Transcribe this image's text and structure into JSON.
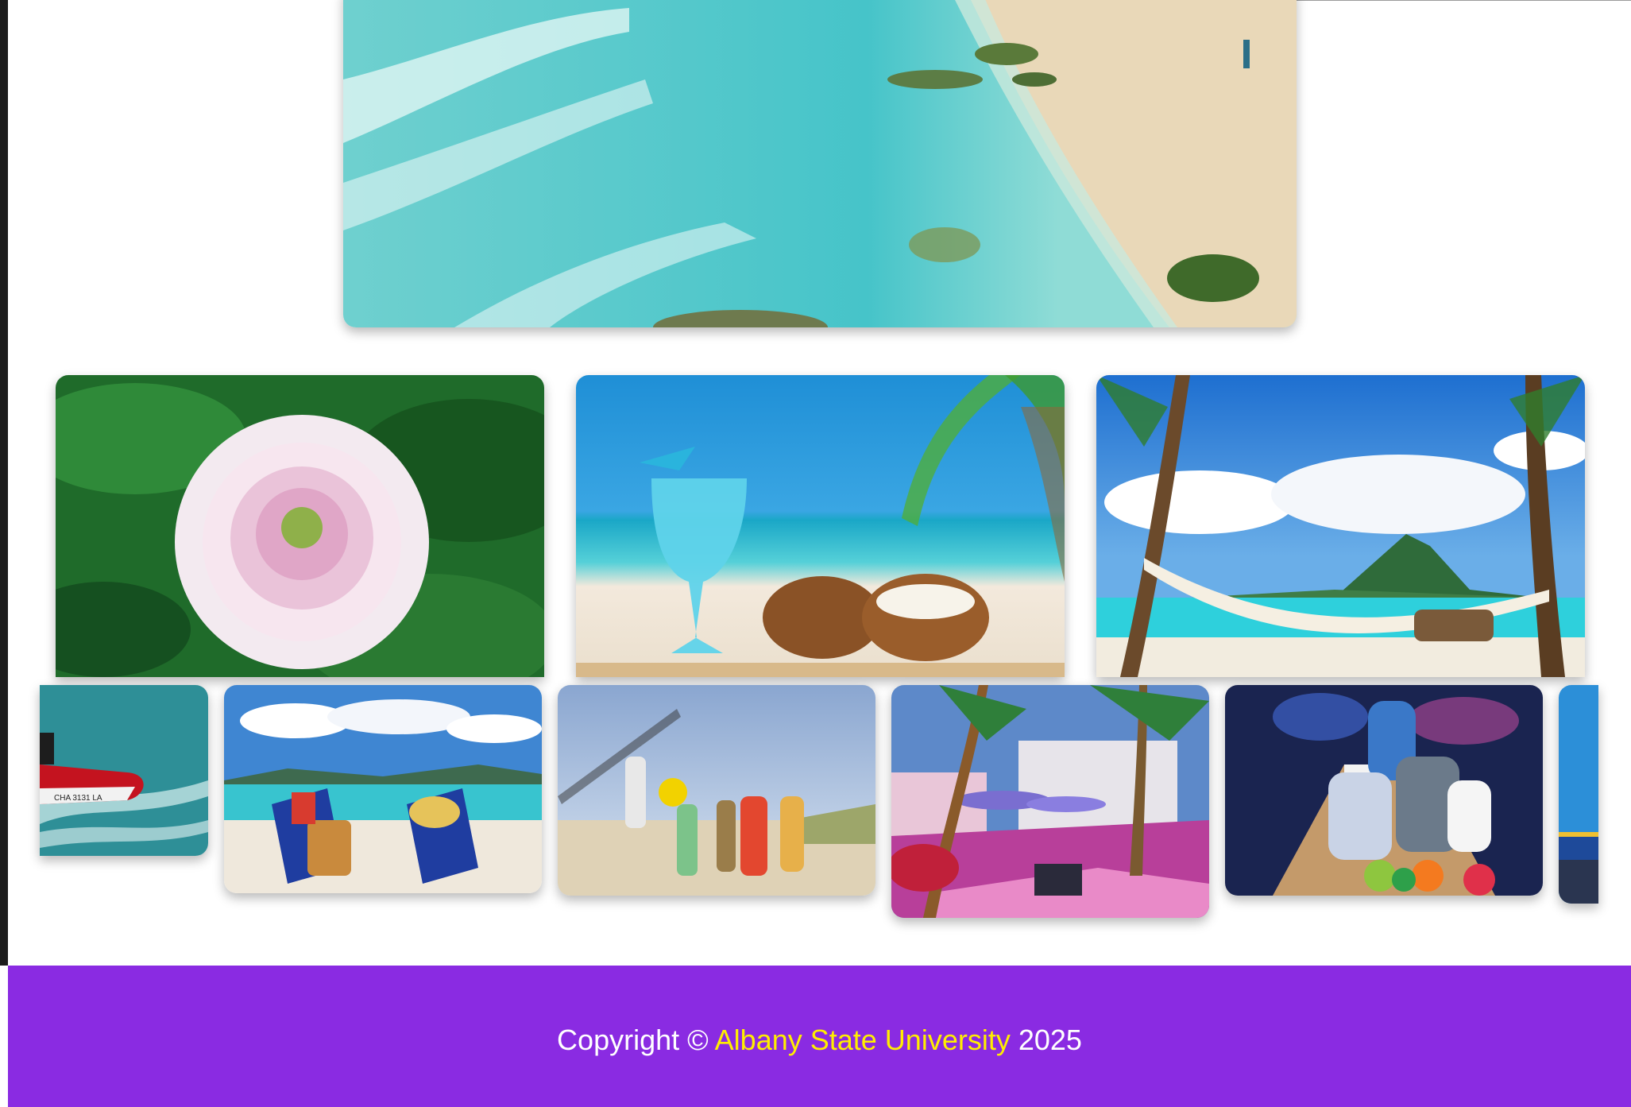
{
  "gallery": {
    "hero": {
      "name": "turquoise-beach-shoreline"
    },
    "row_large": [
      {
        "name": "pink-dahlia-flower"
      },
      {
        "name": "blue-cocktail-and-coconut"
      },
      {
        "name": "palm-tree-hammock-lagoon"
      }
    ],
    "row_small": [
      {
        "name": "red-jet-ski"
      },
      {
        "name": "beach-lounge-chairs"
      },
      {
        "name": "beach-volleyball"
      },
      {
        "name": "neon-resort-plaza"
      },
      {
        "name": "family-bowling"
      },
      {
        "name": "blue-pier"
      }
    ],
    "jetski_hull_text": "CHA 3131 LA"
  },
  "footer": {
    "copyright_prefix": "Copyright ©",
    "organization": "Albany State University",
    "year": "2025"
  },
  "colors": {
    "footer_background": "#8a2be2",
    "footer_text": "#ffffff",
    "organization_link": "#ffee00"
  }
}
